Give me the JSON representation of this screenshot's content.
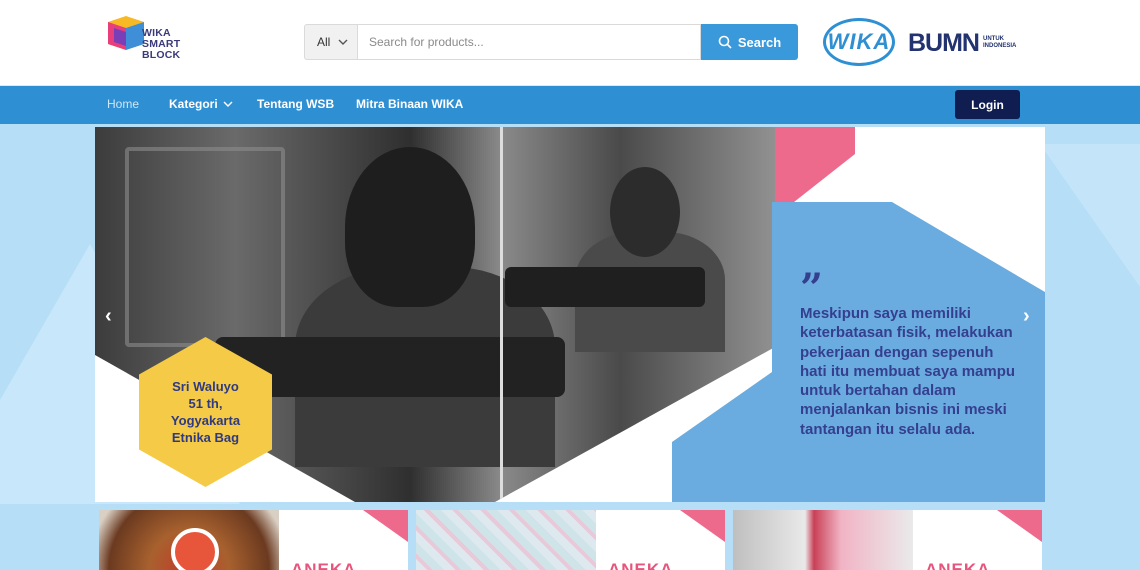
{
  "header": {
    "logo": {
      "line1": "WIKA",
      "line2": "SMART",
      "line3": "BLOCK"
    },
    "search": {
      "category": "All",
      "placeholder": "Search for products...",
      "button_label": "Search"
    },
    "partner_logos": {
      "wika": "WIKA",
      "bumn": "BUMN",
      "bumn_sub1": "UNTUK",
      "bumn_sub2": "INDONESIA"
    }
  },
  "nav": {
    "items": [
      {
        "label": "Home"
      },
      {
        "label": "Kategori"
      },
      {
        "label": "Tentang WSB"
      },
      {
        "label": "Mitra Binaan WIKA"
      }
    ],
    "login_label": "Login"
  },
  "hero": {
    "quote_mark": "”",
    "quote": "Meskipun saya memiliki keterbatasan fisik, melakukan pekerjaan dengan sepenuh hati itu membuat saya mampu untuk bertahan dalam menjalankan bisnis ini meski tantangan itu selalu ada.",
    "person": {
      "name": "Sri Waluyo",
      "age": "51 th,",
      "city": "Yogyakarta",
      "business": "Etnika Bag"
    },
    "prev_arrow": "‹",
    "next_arrow": "›"
  },
  "categories": [
    {
      "label": "ANEKA"
    },
    {
      "label": "ANEKA"
    },
    {
      "label": "ANEKA"
    }
  ],
  "colors": {
    "primary": "#2f8fd3",
    "dark_navy": "#0f1d50",
    "pink": "#ee6a8d",
    "quote_text": "#353f8f",
    "hex_yellow": "#f4ca46"
  },
  "icons": {
    "search": "search-icon",
    "dropdown": "chevron-down-icon"
  }
}
